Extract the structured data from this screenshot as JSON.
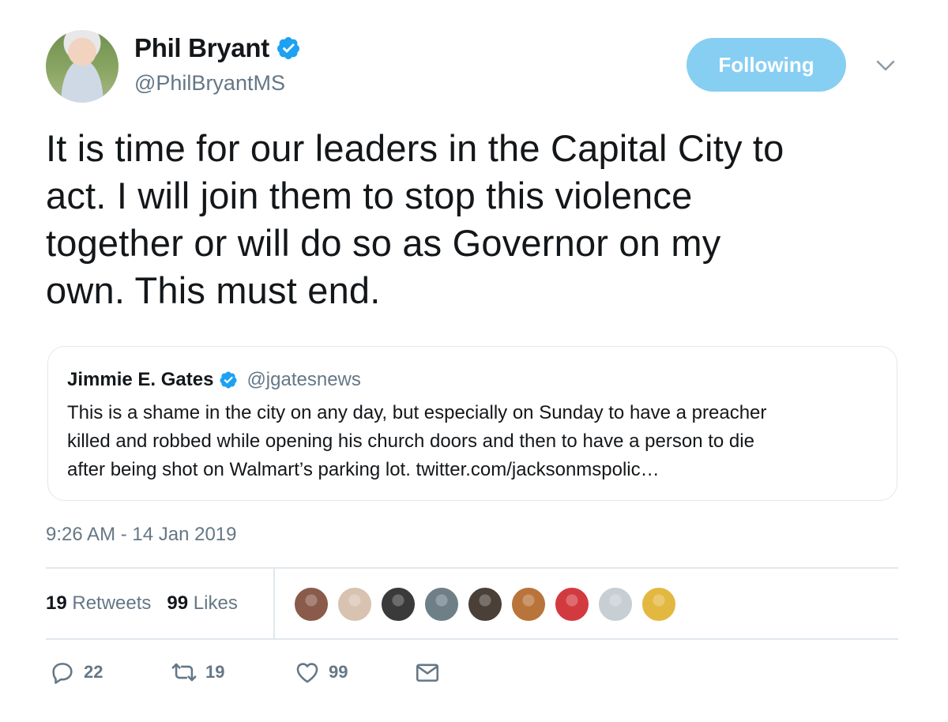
{
  "author": {
    "name": "Phil Bryant",
    "handle": "@PhilBryantMS",
    "verified": true
  },
  "follow_button": {
    "label": "Following"
  },
  "tweet": {
    "lines": [
      "It is time for our leaders in the Capital City to",
      "act. I will join them to stop this violence",
      "together or will do so as Governor on my",
      "own. This must end."
    ]
  },
  "quoted": {
    "name": "Jimmie E. Gates",
    "handle": "@jgatesnews",
    "lines": [
      "This is a shame in the city on any day, but especially on Sunday to have a preacher",
      "killed and robbed while opening his church doors and then to have a person to die",
      "after being shot on Walmart’s parking lot. twitter.com/jacksonmspolic…"
    ]
  },
  "timestamp": "9:26 AM - 14 Jan 2019",
  "stats": {
    "retweets_count": "19",
    "retweets_label": "Retweets",
    "likes_count": "99",
    "likes_label": "Likes"
  },
  "liker_avatars": [
    {
      "color": "#8a5b4a"
    },
    {
      "color": "#d8c2b0"
    },
    {
      "color": "#3a3a3a"
    },
    {
      "color": "#6f7f88"
    },
    {
      "color": "#4a4038"
    },
    {
      "color": "#b8743a"
    },
    {
      "color": "#d33a40"
    },
    {
      "color": "#c7ced4"
    },
    {
      "color": "#e3b840"
    }
  ],
  "actions": {
    "reply_count": "22",
    "retweet_count": "19",
    "like_count": "99"
  },
  "colors": {
    "accent": "#1da1f2",
    "follow_bg": "#87cef3",
    "muted": "#657786"
  }
}
